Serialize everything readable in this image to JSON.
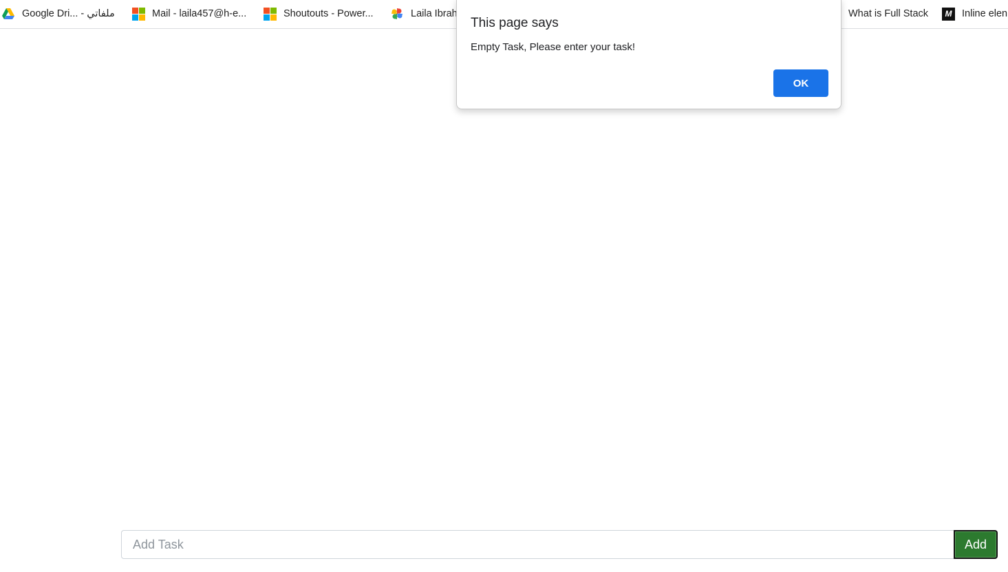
{
  "bookmarks": [
    {
      "label": "Google Dri... - ملفاتي",
      "icon": "google-drive-icon"
    },
    {
      "label": "Mail - laila457@h-e...",
      "icon": "microsoft-icon"
    },
    {
      "label": "Shoutouts - Power...",
      "icon": "microsoft-icon"
    },
    {
      "label": "Laila Ibrah",
      "icon": "google-photos-icon"
    },
    {
      "label": "What is Full Stack",
      "icon": ""
    },
    {
      "label": "Inline elen",
      "icon": "medium-icon"
    }
  ],
  "dialog": {
    "title": "This page says",
    "message": "Empty Task, Please enter your task!",
    "ok_label": "OK"
  },
  "task_form": {
    "input_value": "",
    "input_placeholder": "Add Task",
    "add_label": "Add"
  },
  "colors": {
    "ok_button": "#1a73e8",
    "add_button": "#2c7a2f"
  }
}
